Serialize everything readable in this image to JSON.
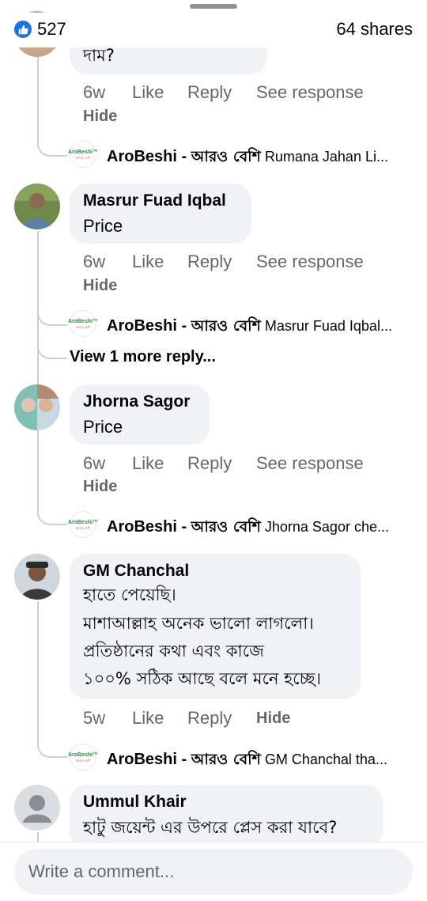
{
  "header": {
    "like_count": "527",
    "shares": "64 shares"
  },
  "colors": {
    "accent": "#1b74e4",
    "bubble": "#f0f2f5",
    "meta": "#65676b",
    "logo_green": "#2a8c3c",
    "logo_red": "#d93025"
  },
  "first_comment": {
    "text_tail": "দাম?",
    "actions": {
      "time": "6w",
      "like": "Like",
      "reply": "Reply",
      "see_response": "See response",
      "hide": "Hide"
    },
    "reply": {
      "page_name": "AroBeshi - ",
      "page_name_bn": "আরও বেশি",
      "snippet": " Rumana Jahan Li..."
    }
  },
  "comments": [
    {
      "author": "Masrur Fuad Iqbal",
      "text": "Price",
      "actions": {
        "time": "6w",
        "like": "Like",
        "reply": "Reply",
        "see_response": "See response",
        "hide": "Hide"
      },
      "reply": {
        "page_name": "AroBeshi - ",
        "page_name_bn": "আরও বেশি",
        "snippet": " Masrur Fuad Iqbal..."
      },
      "view_more": "View 1 more reply..."
    },
    {
      "author": "Jhorna Sagor",
      "text": "Price",
      "actions": {
        "time": "6w",
        "like": "Like",
        "reply": "Reply",
        "see_response": "See response",
        "hide": "Hide"
      },
      "reply": {
        "page_name": "AroBeshi - ",
        "page_name_bn": "আরও বেশি",
        "snippet": " Jhorna Sagor che..."
      }
    },
    {
      "author": "GM Chanchal",
      "lines": [
        "হাতে পেয়েছি।",
        "মাশাআল্লাহ অনেক ভালো লাগলো।",
        "প্রতিষ্ঠানের কথা এবং কাজে",
        "১০০% সঠিক আছে বলে মনে হচ্ছে।"
      ],
      "actions": {
        "time": "5w",
        "like": "Like",
        "reply": "Reply",
        "hide": "Hide"
      },
      "reply": {
        "page_name": "AroBeshi - ",
        "page_name_bn": "আরও বেশি",
        "snippet": " GM Chanchal tha..."
      }
    },
    {
      "author": "Ummul Khair",
      "text": "হাটু জয়েন্ট এর উপরে প্লেস করা যাবে?"
    }
  ],
  "logo": {
    "line1": "AroBeshi™",
    "line2": "আরও বেশি"
  },
  "composer": {
    "placeholder": "Write a comment..."
  }
}
